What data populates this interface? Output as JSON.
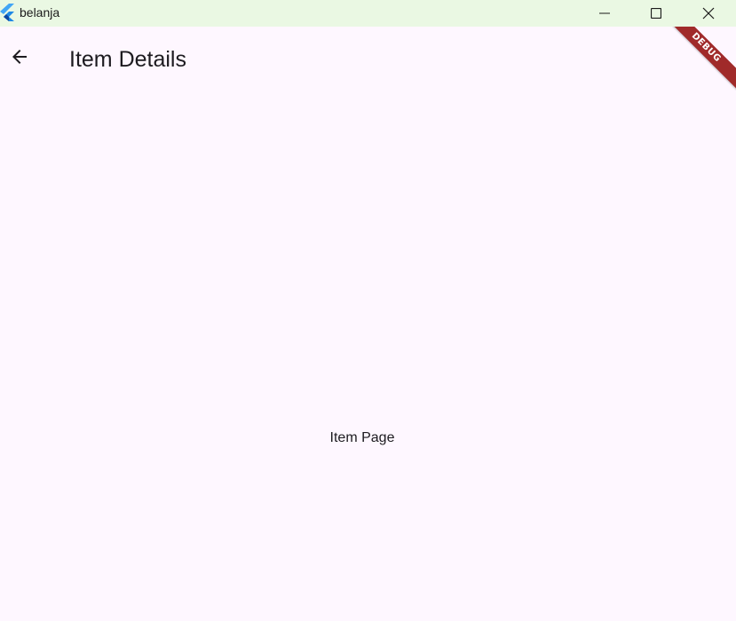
{
  "window": {
    "title": "belanja",
    "icon": "flutter-logo-icon",
    "controls": {
      "minimize_icon": "minimize-icon",
      "maximize_icon": "maximize-icon",
      "close_icon": "close-icon"
    }
  },
  "appbar": {
    "back_icon": "arrow-back-icon",
    "title": "Item Details"
  },
  "body": {
    "text": "Item Page"
  },
  "debug_banner": {
    "label": "DEBUG",
    "color": "#a02a2a"
  },
  "colors": {
    "titlebar_bg": "#eaf8e3",
    "page_bg": "#fef7ff",
    "text": "#1d1b20"
  }
}
